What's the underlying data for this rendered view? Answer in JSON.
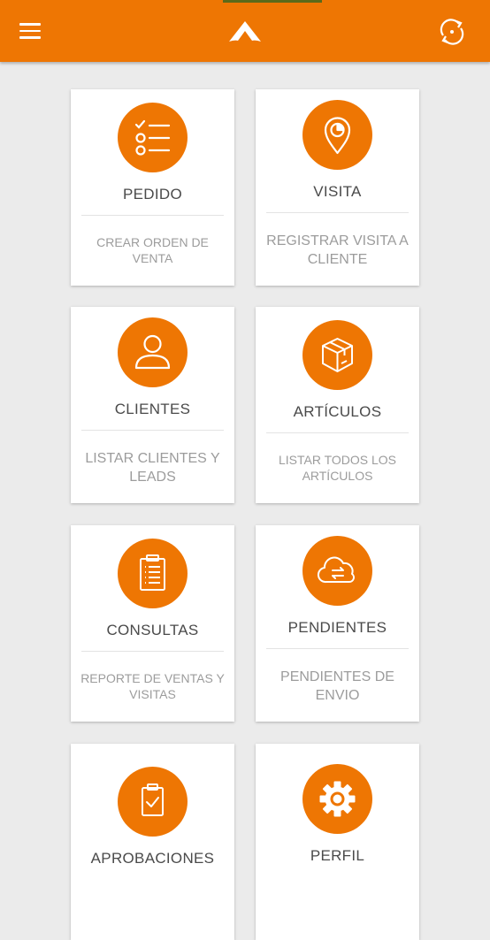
{
  "header": {
    "menu_icon": "hamburger-menu-icon",
    "logo_icon": "brand-chevron-logo",
    "sync_icon": "sync-refresh-icon",
    "background": "#ee7603"
  },
  "cards": [
    {
      "icon": "checklist-icon",
      "title": "PEDIDO",
      "description": "CREAR ORDEN DE VENTA"
    },
    {
      "icon": "location-pin-icon",
      "title": "VISITA",
      "description": "REGISTRAR VISITA A CLIENTE"
    },
    {
      "icon": "user-icon",
      "title": "CLIENTES",
      "description": "LISTAR CLIENTES Y LEADS"
    },
    {
      "icon": "box-icon",
      "title": "ARTÍCULOS",
      "description": "LISTAR TODOS LOS ARTÍCULOS"
    },
    {
      "icon": "clipboard-list-icon",
      "title": "CONSULTAS",
      "description": "REPORTE DE VENTAS Y VISITAS"
    },
    {
      "icon": "cloud-transfer-icon",
      "title": "PENDIENTES",
      "description": "PENDIENTES DE ENVIO"
    },
    {
      "icon": "clipboard-check-icon",
      "title": "APROBACIONES",
      "description": ""
    },
    {
      "icon": "gear-icon",
      "title": "PERFIL",
      "description": ""
    }
  ]
}
